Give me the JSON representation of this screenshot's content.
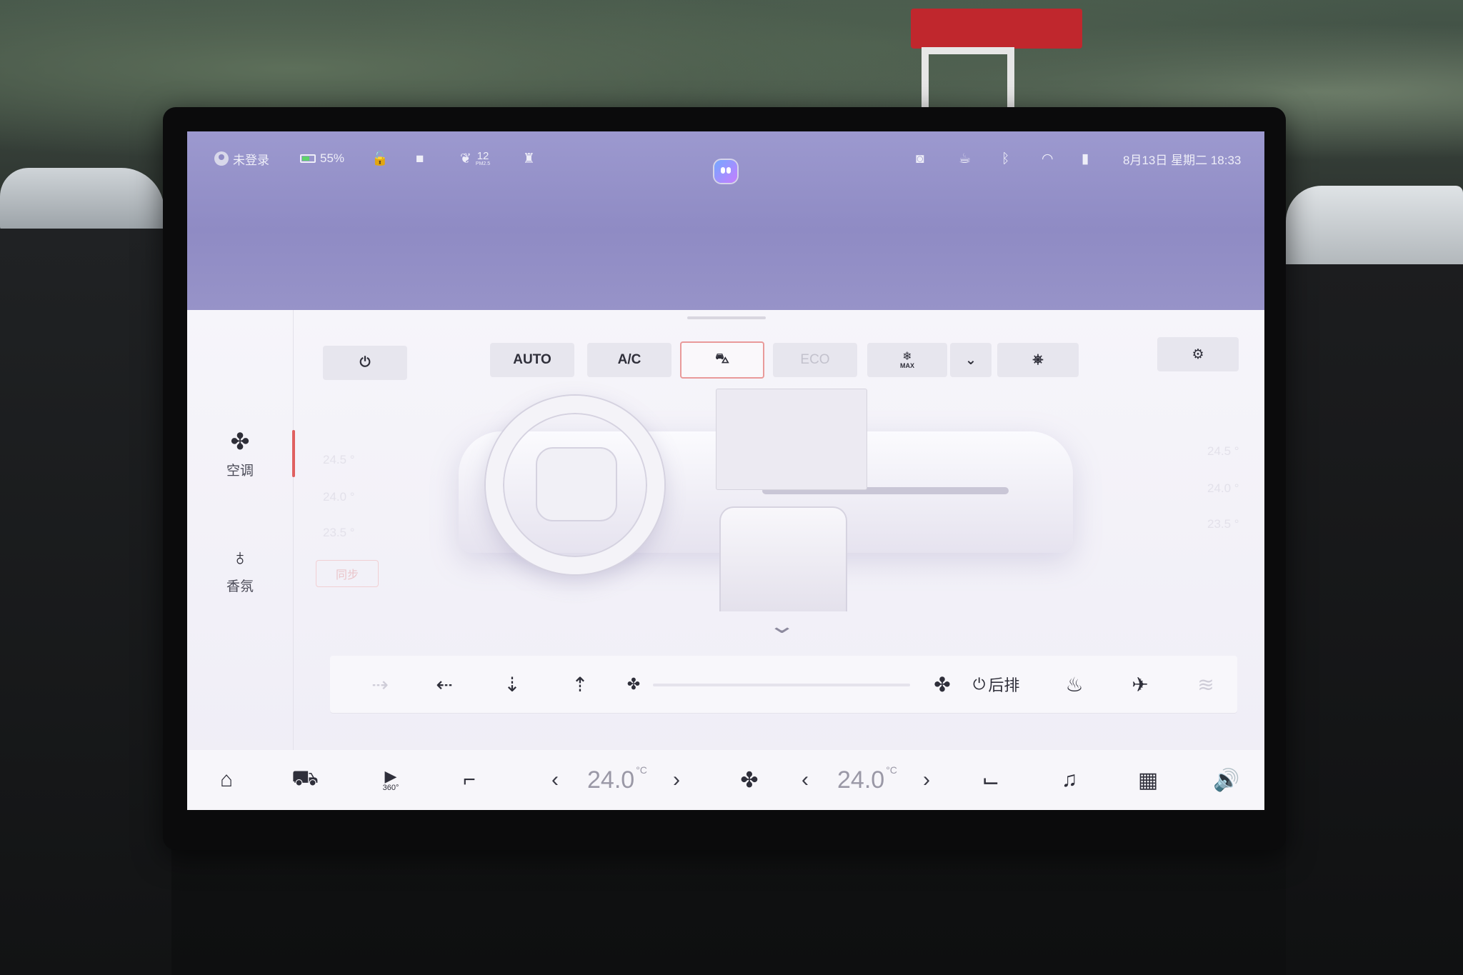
{
  "status_bar": {
    "user": "未登录",
    "battery": "55%",
    "battery_level": 0.55,
    "pm25_value": "12",
    "pm25_label": "PM2.5",
    "datetime": "8月13日 星期二 18:33",
    "icons": [
      "user-icon",
      "battery-icon",
      "unlock-icon",
      "camera-icon",
      "leaf-icon",
      "alarm-icon",
      "assistant-icon",
      "mirror-icon",
      "coffee-cup-icon",
      "bluetooth-icon",
      "wifi-icon",
      "signal-icon"
    ]
  },
  "climate": {
    "mode_buttons": [
      "AUTO",
      "A/C",
      "ECO"
    ],
    "max_label": "MAX",
    "sync_label": "同步",
    "left_temp_scale": [
      "24.5 °",
      "24.0 °",
      "23.5 °"
    ],
    "right_temp_scale": [
      "24.5 °",
      "24.0 °",
      "23.5 °"
    ],
    "rear_label": "后排"
  },
  "sidebar": {
    "items": [
      {
        "label": "空调",
        "icon": "fan-icon"
      },
      {
        "label": "香氛",
        "icon": "fragrance-icon"
      }
    ]
  },
  "dock": {
    "driver_temp": "24.0",
    "passenger_temp": "24.0",
    "unit": "°C",
    "icons": [
      "home-icon",
      "car-icon",
      "camera-360-icon",
      "seat-icon",
      "fan-icon",
      "seat-right-icon",
      "music-icon",
      "apps-icon",
      "volume-icon"
    ],
    "cam_label": "360°"
  },
  "colors": {
    "top_band": "#8f8bc4",
    "active_accent": "#e06060",
    "panel": "#f4f2f8"
  }
}
